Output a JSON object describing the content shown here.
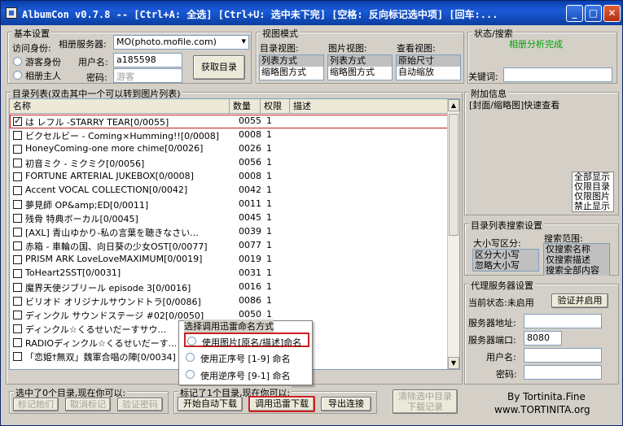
{
  "window": {
    "title": "AlbumCon v0.7.8 -- [Ctrl+A: 全选] [Ctrl+U: 选中未下完] [空格: 反向标记选中项] [回车:..."
  },
  "basic": {
    "legend": "基本设置",
    "identity_label": "访问身份:",
    "guest": "游客身份",
    "owner": "相册主人",
    "server_label": "相册服务器:",
    "server_value": "MO(photo.mofile.com)",
    "user_label": "用户名:",
    "user_value": "a185598",
    "pwd_label": "密码:",
    "pwd_placeholder": "游客",
    "fetch": "获取目录"
  },
  "view": {
    "legend": "视图模式",
    "dir_label": "目录视图:",
    "pic_label": "图片视图:",
    "look_label": "查看视图:",
    "dir_items": [
      "列表方式",
      "缩略图方式"
    ],
    "pic_items": [
      "列表方式",
      "缩略图方式"
    ],
    "look_items": [
      "原始尺寸",
      "自动缩放"
    ]
  },
  "status": {
    "legend": "状态/搜索",
    "message": "相册分析完成",
    "keyword_label": "关键词:"
  },
  "list": {
    "legend": "目录列表(双击其中一个可以转到图片列表)",
    "cols": {
      "name": "名称",
      "num": "数量",
      "perm": "权限",
      "desc": "描述"
    },
    "rows": [
      {
        "name": "は レフル -STARRY TEAR[0/0055]",
        "num": "0055",
        "perm": "1"
      },
      {
        "name": "ビクセルビー - Coming×Humming!![0/0008]",
        "num": "0008",
        "perm": "1"
      },
      {
        "name": "HoneyComing-one more chime[0/0026]",
        "num": "0026",
        "perm": "1"
      },
      {
        "name": "初音ミク - ミクミク[0/0056]",
        "num": "0056",
        "perm": "1"
      },
      {
        "name": "FORTUNE ARTERIAL JUKEBOX[0/0008]",
        "num": "0008",
        "perm": "1"
      },
      {
        "name": "Accent VOCAL COLLECTION[0/0042]",
        "num": "0042",
        "perm": "1"
      },
      {
        "name": "夢見師 OP&amp;ED[0/0011]",
        "num": "0011",
        "perm": "1"
      },
      {
        "name": "残骨 特典ボーカル[0/0045]",
        "num": "0045",
        "perm": "1"
      },
      {
        "name": "[AXL] 青山ゆかり-私の言葉を聴きなさい...",
        "num": "0039",
        "perm": "1"
      },
      {
        "name": "赤箱 - 車輪の国、向日葵の少女OST[0/0077]",
        "num": "0077",
        "perm": "1"
      },
      {
        "name": "PRISM ARK LoveLoveMAXIMUM[0/0019]",
        "num": "0019",
        "perm": "1"
      },
      {
        "name": "ToHeart2SST[0/0031]",
        "num": "0031",
        "perm": "1"
      },
      {
        "name": "魔界天使ジブリール episode 3[0/0016]",
        "num": "0016",
        "perm": "1"
      },
      {
        "name": "ビリオド オリジナルサウンドトラ[0/0086]",
        "num": "0086",
        "perm": "1"
      },
      {
        "name": "ディンクル サウンドステージ #02[0/0050]",
        "num": "0050",
        "perm": "1"
      },
      {
        "name": "ディンクル☆くるせいだーすサウ...",
        "num": "",
        "perm": ""
      },
      {
        "name": "RADIOディンクル☆くるせいだーす...",
        "num": "",
        "perm": ""
      },
      {
        "name": "「恋姫†無双」魏軍合唱の陣[0/0034]",
        "num": "",
        "perm": ""
      }
    ]
  },
  "popup": {
    "title": "选择调用迅雷命名方式",
    "opt1": "使用图片[原名/描述]命名",
    "opt2": "使用正序号 [1-9] 命名",
    "opt3": "使用逆序号 [9-1] 命名"
  },
  "selected": {
    "legend": "选中了0个目录,现在你可以:",
    "mark": "标记她们",
    "unmark": "取消标记",
    "verify": "验证密码"
  },
  "marked": {
    "legend": "标记了1个目录,现在你可以:",
    "auto": "开始自动下载",
    "thunder": "调用迅雷下载",
    "export": "导出连接"
  },
  "clear": {
    "line1": "清除选中目录",
    "line2": "下载记录"
  },
  "extra": {
    "legend": "附加信息",
    "preview_label": "[封面/缩略图]快速查看",
    "filter_items": [
      "全部显示",
      "仅限目录",
      "仅限图片",
      "禁止显示"
    ]
  },
  "search": {
    "legend": "目录列表搜索设置",
    "case_label": "大小写区分:",
    "case_items": [
      "区分大小写",
      "忽略大小写"
    ],
    "range_label": "搜索范围:",
    "range_items": [
      "仅搜索名称",
      "仅搜索描述",
      "搜索全部内容"
    ]
  },
  "proxy": {
    "legend": "代理服务器设置",
    "state_label": "当前状态:未启用",
    "verify": "验证并启用",
    "addr_label": "服务器地址:",
    "port_label": "服务器端口:",
    "port_value": "8080",
    "user_label": "用户名:",
    "pwd_label": "密码:"
  },
  "credit": {
    "line1": "By Tortinita.Fine",
    "line2": "www.TORTINITA.org"
  }
}
